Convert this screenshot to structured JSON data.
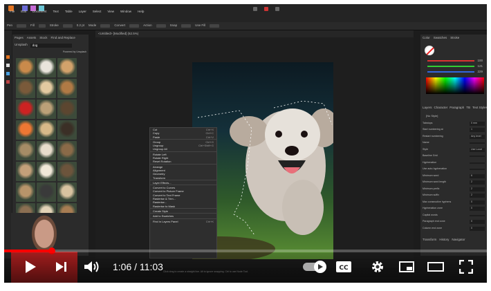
{
  "menu": [
    "File",
    "Edit",
    "Document",
    "Text",
    "Table",
    "Layer",
    "Select",
    "View",
    "Window",
    "Help"
  ],
  "toolbar": [
    "Pen",
    "Fill",
    "Stroke",
    "Mode",
    "Convert",
    "Action",
    "Snap",
    "Use Fill"
  ],
  "stroke_width": "0.2 pt",
  "document_tab": "<Untitled> [Modified] (62.5%)",
  "left_panel": {
    "tabs": [
      "Pages",
      "Assets",
      "Stock",
      "Find and Replace"
    ],
    "source": "Unsplash",
    "query": "dog",
    "powered_by": "Powered by Unsplash"
  },
  "context_menu": [
    [
      "Cut",
      "Ctrl+X"
    ],
    [
      "Copy",
      "Ctrl+C"
    ],
    [
      "Paste",
      "Ctrl+V"
    ],
    [
      "",
      ""
    ],
    [
      "Group",
      "Ctrl+G"
    ],
    [
      "Ungroup",
      "Ctrl+Shift+G"
    ],
    [
      "Ungroup All",
      ""
    ],
    [
      "",
      ""
    ],
    [
      "Rotate Left",
      ""
    ],
    [
      "Rotate Right",
      ""
    ],
    [
      "Reset Rotation",
      ""
    ],
    [
      "",
      ""
    ],
    [
      "Arrange",
      ""
    ],
    [
      "Alignment",
      ""
    ],
    [
      "Geometry",
      ""
    ],
    [
      "Transform",
      ""
    ],
    [
      "",
      ""
    ],
    [
      "Layer Effects...",
      ""
    ],
    [
      "",
      ""
    ],
    [
      "Convert to Curves",
      ""
    ],
    [
      "Convert to Picture Frame",
      ""
    ],
    [
      "Convert to Text Frame",
      ""
    ],
    [
      "Rasterise & Trim...",
      ""
    ],
    [
      "Rasterise...",
      ""
    ],
    [
      "Rasterise to Mask",
      ""
    ],
    [
      "",
      ""
    ],
    [
      "Create Style",
      ""
    ],
    [
      "",
      ""
    ],
    [
      "Add to Swatches",
      ""
    ],
    [
      "",
      ""
    ],
    [
      "Find in Layers Panel",
      "Ctrl+K"
    ]
  ],
  "right_panel": {
    "tabs": [
      "Color",
      "Swatches",
      "Stroke"
    ],
    "hsl_values": [
      "100",
      "121",
      "229"
    ],
    "para_tabs": [
      "Layers",
      "Character",
      "Paragraph",
      "TB",
      "Text Styles"
    ],
    "style": "[No Style]",
    "fields": [
      [
        "Tabstops",
        "0 mm"
      ],
      [
        "Start numbering at",
        "1"
      ],
      [
        "Restart numbering",
        "Any level"
      ],
      [
        "Name",
        ""
      ],
      [
        "Style",
        "Use Local"
      ],
      [
        "Baseline Grid",
        ""
      ],
      [
        "Hyphenation",
        ""
      ],
      [
        "Use auto-hyphenation",
        ""
      ],
      [
        "Minimum word",
        "6"
      ],
      [
        "Minimum word length",
        "2"
      ],
      [
        "Minimum prefix",
        "2"
      ],
      [
        "Minimum suffix",
        "2"
      ],
      [
        "Max consecutive hyphens",
        "0"
      ],
      [
        "Hyphenation zone",
        "0"
      ],
      [
        "Capital words",
        ""
      ],
      [
        "Paragraph end zone",
        "0"
      ],
      [
        "Column end zone",
        "0"
      ]
    ],
    "bottom_tabs": [
      "Transform",
      "History",
      "Navigator"
    ]
  },
  "status_hint": "Click drag to create a straight line. Alt to ignore snapping. Ctrl to use Node Tool.",
  "player": {
    "elapsed": "1:06",
    "duration": "11:03",
    "time_display": "1:06 / 11:03",
    "progress_fraction": 0.0995,
    "accent": "#ff0000"
  }
}
